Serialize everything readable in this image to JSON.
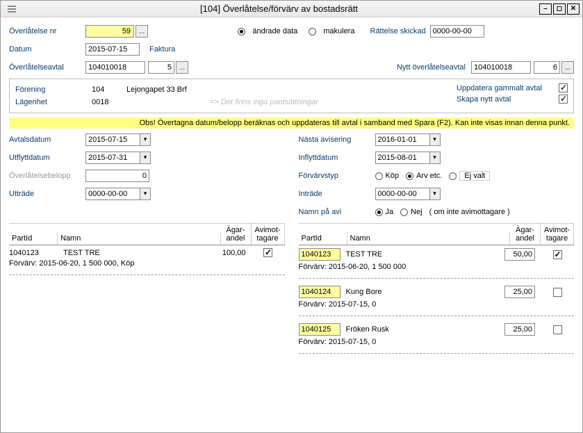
{
  "window": {
    "title": "[104]  Överlåtelse/förvärv av bostadsrätt"
  },
  "top": {
    "overlatelse_nr_label": "Överlåtelse nr",
    "overlatelse_nr": "59",
    "andrade_label": "ändrade data",
    "makulera_label": "makulera",
    "rattelse_label": "Rättelse skickad",
    "rattelse_date": "0000-00-00",
    "datum_label": "Datum",
    "datum": "2015-07-15",
    "faktura_label": "Faktura",
    "overlatelseavtal_label": "Överlåtelseavtal",
    "overlatelseavtal_id": "104010018",
    "overlatelseavtal_seq": "5",
    "nytt_label": "Nytt överlåtelseavtal",
    "nytt_id": "104010018",
    "nytt_seq": "6"
  },
  "box": {
    "forening_label": "Förening",
    "forening_id": "104",
    "forening_name": "Lejongapet 33 Brf",
    "lagenhet_label": "Lägenhet",
    "lagenhet_id": "0018",
    "pant_hint": "=> Det finns inga pantsättningar",
    "uppdatera_label": "Uppdatera gammalt avtal",
    "skapa_label": "Skapa nytt avtal"
  },
  "warning": "Obs! Övertagna datum/belopp beräknas och uppdateras till avtal i samband med Spara (F2). Kan inte visas innan denna punkt.",
  "left": {
    "avtalsdatum_label": "Avtalsdatum",
    "avtalsdatum": "2015-07-15",
    "utflytt_label": "Utflyttdatum",
    "utflytt": "2015-07-31",
    "belopp_label": "Överlåtelsebelopp",
    "belopp": "0",
    "uttrade_label": "Utträde",
    "uttrade": "0000-00-00"
  },
  "right": {
    "nasta_label": "Nästa avisering",
    "nasta": "2016-01-01",
    "inflytt_label": "Inflyttdatum",
    "inflytt": "2015-08-01",
    "forvarv_label": "Förvärvstyp",
    "kop": "Köp",
    "arv": "Arv etc.",
    "ej": "Ej valt",
    "intrade_label": "Inträde",
    "intrade": "0000-00-00",
    "namnavi_label": "Namn på avi",
    "ja": "Ja",
    "nej": "Nej",
    "avinote": "( om inte avimottagare )"
  },
  "head": {
    "part": "PartId",
    "namn": "Namn",
    "andel": "Ägar-\nandel",
    "avi": "Avimot-\ntagare"
  },
  "leftParties": [
    {
      "id": "1040123",
      "name": "TEST TRE",
      "andel": "100,00",
      "avi": true,
      "sub": "Förvärv: 2015-06-20, 1 500 000, Köp"
    }
  ],
  "rightParties": [
    {
      "id": "1040123",
      "name": "TEST TRE",
      "andel": "50,00",
      "avi": true,
      "sub": "Förvärv: 2015-06-20, 1 500 000"
    },
    {
      "id": "1040124",
      "name": "Kung Bore",
      "andel": "25,00",
      "avi": false,
      "sub": "Förvärv: 2015-07-15, 0"
    },
    {
      "id": "1040125",
      "name": "Fröken Rusk",
      "andel": "25,00",
      "avi": false,
      "sub": "Förvärv: 2015-07-15, 0"
    }
  ]
}
